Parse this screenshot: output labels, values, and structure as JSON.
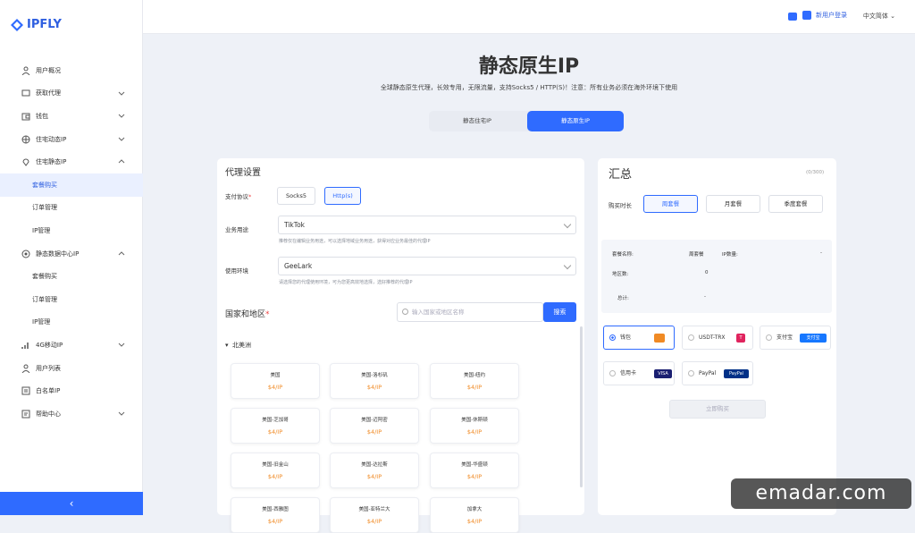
{
  "brand": {
    "name": "IPFLY"
  },
  "sidebar": {
    "items": [
      {
        "label": "用户概况",
        "icon": "user-icon",
        "expandable": false
      },
      {
        "label": "获取代理",
        "icon": "download-icon",
        "expandable": true
      },
      {
        "label": "钱包",
        "icon": "wallet-icon",
        "expandable": true
      },
      {
        "label": "住宅动态IP",
        "icon": "globe-icon",
        "expandable": true
      },
      {
        "label": "住宅静态IP",
        "icon": "pin-icon",
        "expandable": true,
        "expanded": true
      },
      {
        "label": "套餐购买",
        "sub": true,
        "active": true
      },
      {
        "label": "订单管理",
        "sub": true
      },
      {
        "label": "IP管理",
        "sub": true
      },
      {
        "label": "静态数据中心IP",
        "icon": "server-icon",
        "expandable": true,
        "expanded": true
      },
      {
        "label": "套餐购买",
        "sub": true
      },
      {
        "label": "订单管理",
        "sub": true
      },
      {
        "label": "IP管理",
        "sub": true
      },
      {
        "label": "4G移动IP",
        "icon": "signal-icon",
        "expandable": true
      },
      {
        "label": "用户列表",
        "icon": "users-icon",
        "expandable": false
      },
      {
        "label": "白名单IP",
        "icon": "list-icon",
        "expandable": false
      },
      {
        "label": "帮助中心",
        "icon": "help-icon",
        "expandable": true
      }
    ],
    "collapse_glyph": "‹"
  },
  "topbar": {
    "user": "新用户登录",
    "lang": "中文简体"
  },
  "page": {
    "title": "静态原生IP",
    "subtitle": "全球静态原生代理，长效专用，无限流量，支持Socks5 / HTTP(S)！注意：所有业务必须在海外环境下使用",
    "tabs": [
      "静态住宅IP",
      "静态原生IP"
    ],
    "active_tab": 1
  },
  "proxy": {
    "heading": "代理设置",
    "protocol_label": "支付协议",
    "protocols": [
      "Socks5",
      "Http(s)"
    ],
    "protocol_selected": 1,
    "usage_label": "业务用途",
    "usage_value": "TikTok",
    "usage_hint": "推荐仅在编辑业务用途，可以选择地域业务用途，获得对应业务最佳的代理IP",
    "env_label": "使用环境",
    "env_value": "GeeLark",
    "env_hint": "请选择您的代理使用环境，可为您更高效地选择，选好推荐的代理IP",
    "region_heading": "国家和地区",
    "search_placeholder": "输入国家或地区名称",
    "search_btn": "搜索",
    "region_group": "北美洲",
    "locations": [
      {
        "name": "美国",
        "price": "$4/IP"
      },
      {
        "name": "美国-洛杉矶",
        "price": "$4/IP"
      },
      {
        "name": "美国-纽约",
        "price": "$4/IP"
      },
      {
        "name": "美国-芝加哥",
        "price": "$4/IP"
      },
      {
        "name": "美国-迈阿密",
        "price": "$4/IP"
      },
      {
        "name": "美国-休斯顿",
        "price": "$4/IP"
      },
      {
        "name": "美国-旧金山",
        "price": "$4/IP"
      },
      {
        "name": "美国-达拉斯",
        "price": "$4/IP"
      },
      {
        "name": "美国-华盛顿",
        "price": "$4/IP"
      },
      {
        "name": "美国-西雅图",
        "price": "$4/IP"
      },
      {
        "name": "美国-亚特兰大",
        "price": "$4/IP"
      },
      {
        "name": "加拿大",
        "price": "$4/IP"
      }
    ]
  },
  "summary": {
    "heading": "汇总",
    "count": "(0/300)",
    "period_label": "购买时长",
    "periods": [
      "周套餐",
      "月套餐",
      "季度套餐"
    ],
    "period_selected": 0,
    "pkg_label": "套餐名称:",
    "pkg_value": "周套餐",
    "region_label": "地区数:",
    "region_value": "0",
    "ipcount_label": "IP数量:",
    "ipcount_value": "-",
    "total_label": "总计:",
    "total_value": "-",
    "payments": [
      {
        "label": "钱包",
        "badge": "",
        "color": "#f08a24",
        "active": true
      },
      {
        "label": "USDT-TRX",
        "badge": "T",
        "color": "#e0245e"
      },
      {
        "label": "支付宝",
        "badge": "支付宝",
        "color": "#1677ff"
      },
      {
        "label": "信用卡",
        "badge": "VISA",
        "color": "#1a1f71"
      },
      {
        "label": "PayPal",
        "badge": "PayPal",
        "color": "#003087"
      }
    ],
    "buy_btn": "立即购买"
  },
  "watermark": "emadar.com"
}
